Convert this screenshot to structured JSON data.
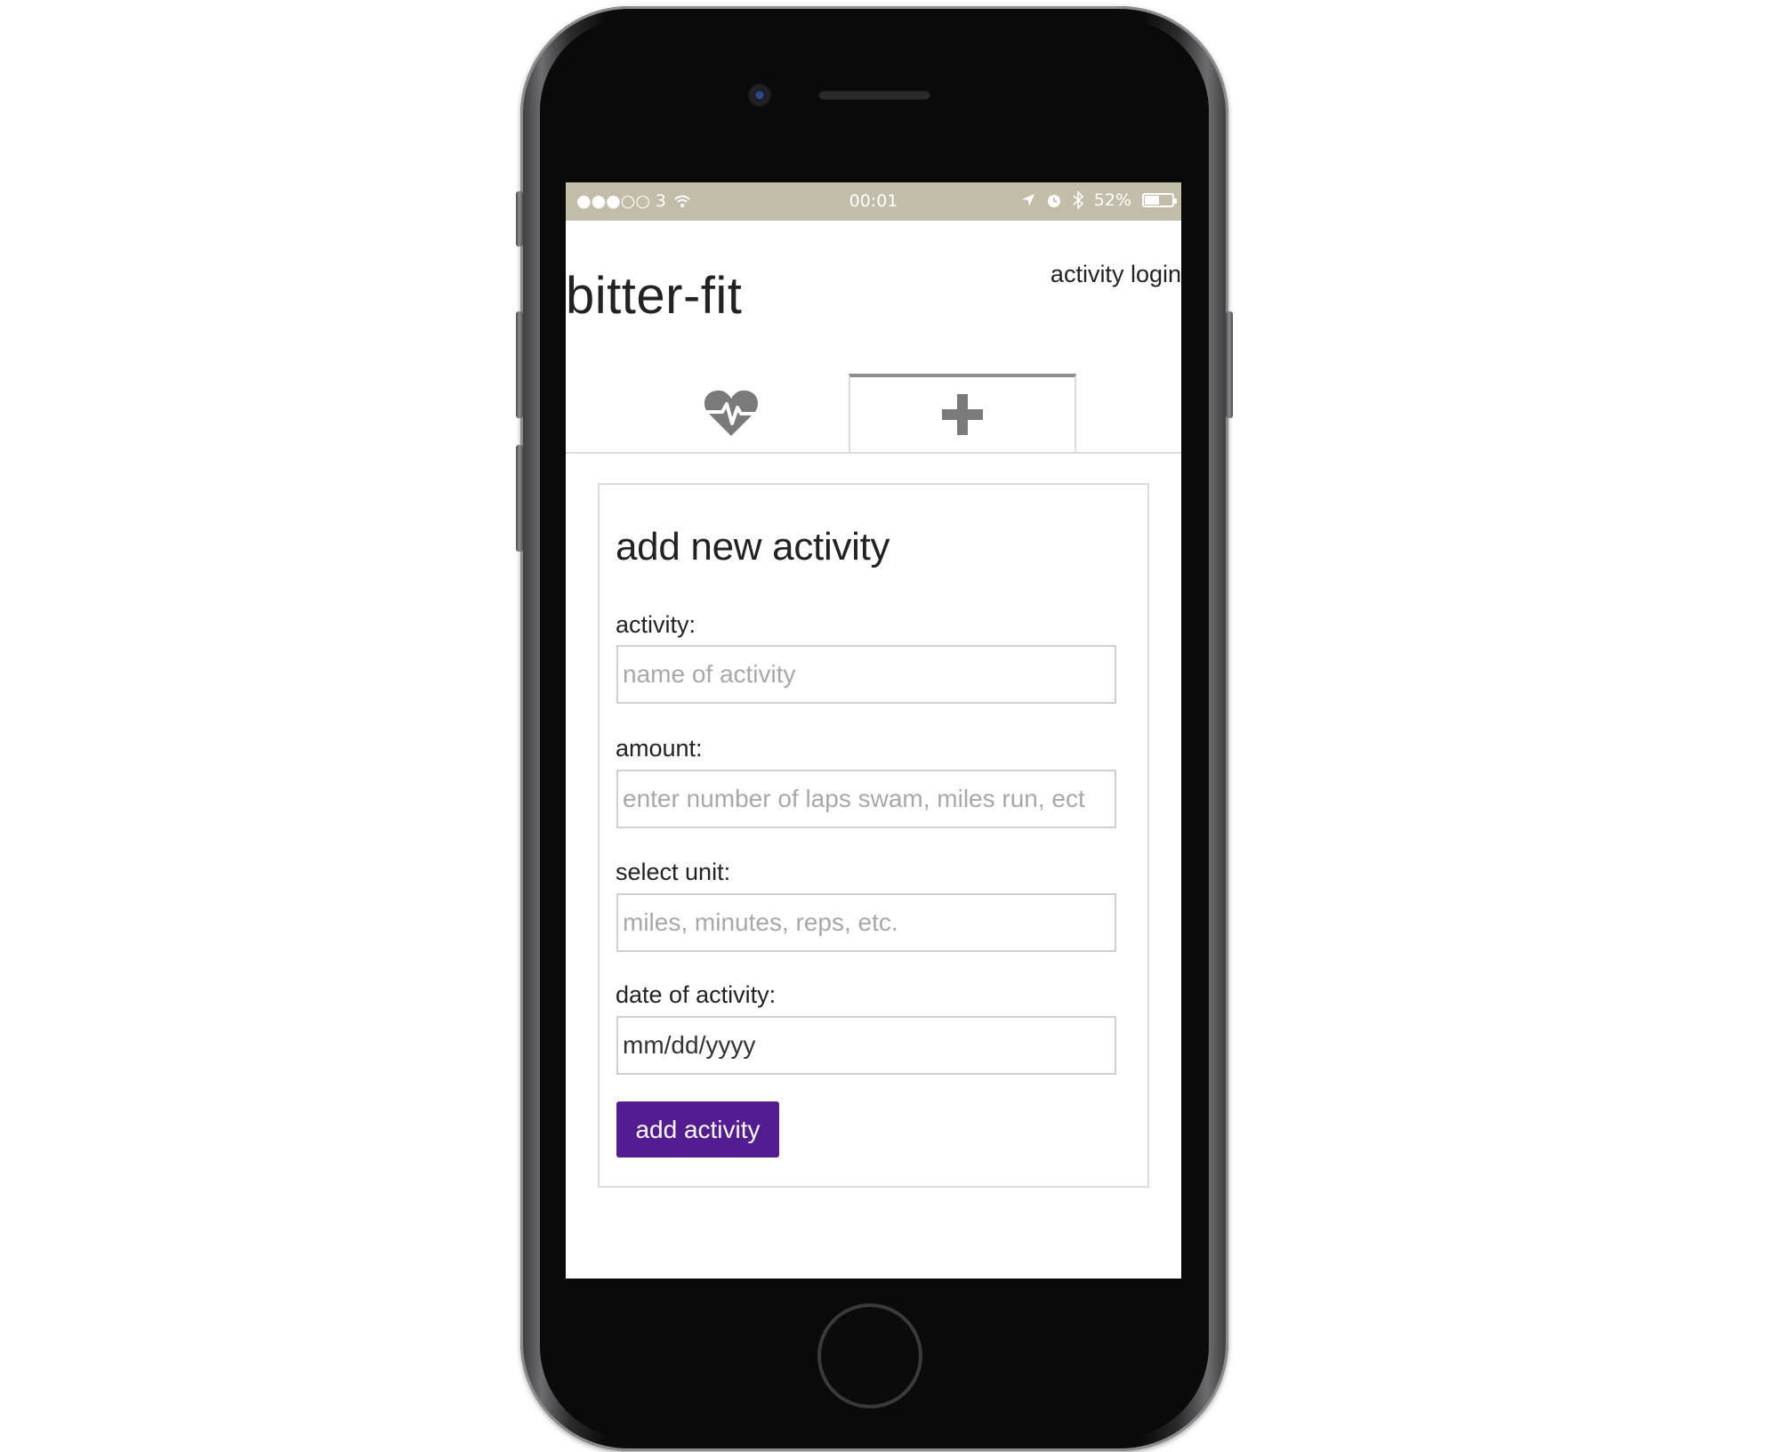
{
  "status_bar": {
    "carrier": "●●●○○ 3",
    "time": "00:01",
    "battery_percent": "52%",
    "battery_level": 0.52,
    "icons": [
      "wifi-icon",
      "location-arrow-icon",
      "alarm-icon",
      "bluetooth-icon",
      "battery-icon"
    ]
  },
  "header": {
    "brand": "bitter-fit",
    "login_link": "activity login"
  },
  "tabs": [
    {
      "icon": "heartbeat-icon",
      "active": false
    },
    {
      "icon": "plus-icon",
      "active": true
    }
  ],
  "form": {
    "title": "add new activity",
    "activity_label": "activity:",
    "activity_placeholder": "name of activity",
    "amount_label": "amount:",
    "amount_placeholder": "enter number of laps swam, miles run, ect",
    "unit_label": "select unit:",
    "unit_placeholder": "miles, minutes, reps, etc.",
    "date_label": "date of activity:",
    "date_value": "mm/dd/yyyy",
    "submit_label": "add activity"
  },
  "colors": {
    "status_bar_bg": "#c2bda9",
    "button_bg": "#531c91",
    "icon_gray": "#7a7a7a"
  }
}
